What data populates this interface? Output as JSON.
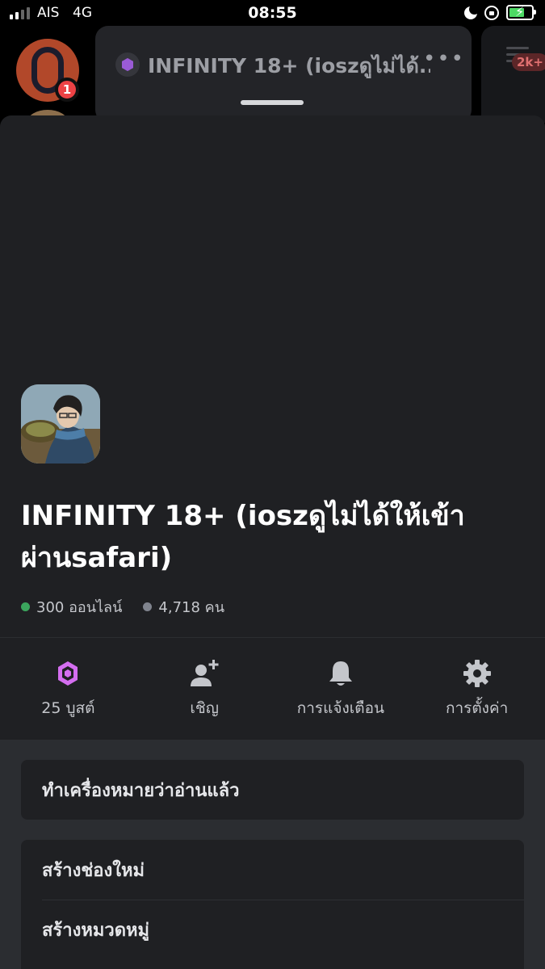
{
  "status_bar": {
    "carrier": "AIS",
    "network": "4G",
    "time": "08:55",
    "icons": [
      "signal-icon",
      "moon-icon",
      "rotation-lock-icon",
      "battery-charging-icon"
    ]
  },
  "background": {
    "server_unread_count": "1",
    "channel_title": "INFINITY 18+ (ioszดูไม่ได้...",
    "more_label": "•••",
    "member_count_badge": "2k+"
  },
  "server": {
    "name": "INFINITY 18+ (ioszดูไม่ได้ให้เข้าผ่านsafari)",
    "online": "300 ออนไลน์",
    "members": "4,718 คน"
  },
  "actions": [
    {
      "icon": "boost-icon",
      "label": "25 บูสต์",
      "color": "#d46ef0"
    },
    {
      "icon": "add-user-icon",
      "label": "เชิญ"
    },
    {
      "icon": "bell-icon",
      "label": "การแจ้งเตือน"
    },
    {
      "icon": "gear-icon",
      "label": "การตั้งค่า"
    }
  ],
  "menu": {
    "mark_read": "ทำเครื่องหมายว่าอ่านแล้ว",
    "create_channel": "สร้างช่องใหม่",
    "create_category": "สร้างหมวดหมู่"
  },
  "colors": {
    "sheet_bg": "#1f2023",
    "online": "#3ba55d",
    "boost": "#d46ef0",
    "badge": "#ed4245"
  }
}
